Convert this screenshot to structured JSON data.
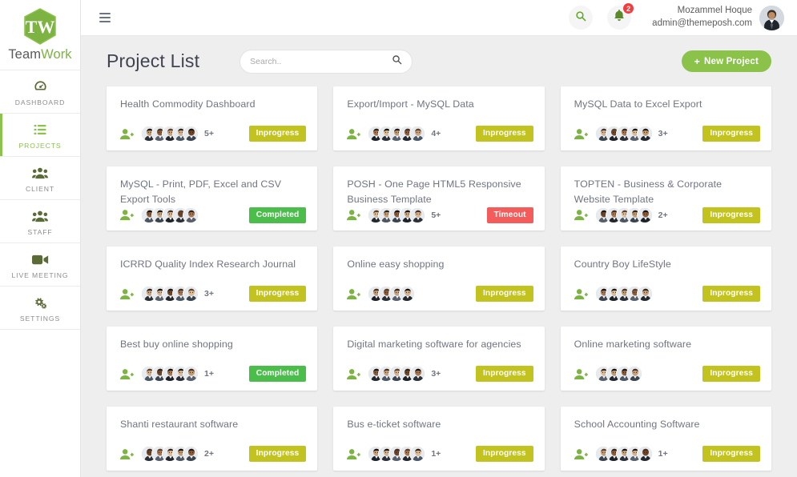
{
  "brand": {
    "name_part1": "Team",
    "name_part2": "Work",
    "logo_text": "TW"
  },
  "sidebar": {
    "items": [
      {
        "label": "DASHBOARD",
        "icon": "dashboard-icon",
        "active": false
      },
      {
        "label": "PROJECTS",
        "icon": "list-icon",
        "active": true
      },
      {
        "label": "CLIENT",
        "icon": "users-icon",
        "active": false
      },
      {
        "label": "STAFF",
        "icon": "users-icon",
        "active": false
      },
      {
        "label": "LIVE MEETING",
        "icon": "video-camera-icon",
        "active": false
      },
      {
        "label": "SETTINGS",
        "icon": "gears-icon",
        "active": false
      }
    ]
  },
  "topbar": {
    "menu_toggle_icon": "hamburger-icon",
    "search_icon": "search-icon",
    "notification_icon": "bell-icon",
    "notification_count": "2",
    "user_name": "Mozammel Hoque",
    "user_email": "admin@themeposh.com",
    "avatar_icon": "user-avatar"
  },
  "page": {
    "title": "Project List",
    "search_placeholder": "Search..",
    "search_value": "",
    "search_icon": "search-icon",
    "new_project_label": "New Project",
    "new_project_plus": "+"
  },
  "colors": {
    "accent_green": "#8bc34a",
    "status_inprogress": "#c2c31e",
    "status_completed": "#4bbd4b",
    "status_timeout": "#f45b5b",
    "badge_red": "#f03e3e",
    "page_background": "#eeeeee"
  },
  "projects": [
    {
      "title": "Health Commodity Dashboard",
      "members": 5,
      "count": "5+",
      "status": "Inprogress",
      "status_class": "st-inprogress"
    },
    {
      "title": "Export/Import - MySQL Data",
      "members": 5,
      "count": "4+",
      "status": "Inprogress",
      "status_class": "st-inprogress"
    },
    {
      "title": "MySQL Data to Excel Export",
      "members": 5,
      "count": "3+",
      "status": "Inprogress",
      "status_class": "st-inprogress"
    },
    {
      "title": "MySQL - Print, PDF, Excel and CSV Export Tools",
      "members": 5,
      "count": "",
      "status": "Completed",
      "status_class": "st-completed"
    },
    {
      "title": "POSH - One Page HTML5 Responsive Business Template",
      "members": 5,
      "count": "5+",
      "status": "Timeout",
      "status_class": "st-timeout"
    },
    {
      "title": "TOPTEN - Business & Corporate Website Template",
      "members": 5,
      "count": "2+",
      "status": "Inprogress",
      "status_class": "st-inprogress"
    },
    {
      "title": "ICRRD Quality Index Research Journal",
      "members": 5,
      "count": "3+",
      "status": "Inprogress",
      "status_class": "st-inprogress"
    },
    {
      "title": "Online easy shopping",
      "members": 4,
      "count": "",
      "status": "Inprogress",
      "status_class": "st-inprogress"
    },
    {
      "title": "Country Boy LifeStyle",
      "members": 5,
      "count": "",
      "status": "Inprogress",
      "status_class": "st-inprogress"
    },
    {
      "title": "Best buy online shopping",
      "members": 5,
      "count": "1+",
      "status": "Completed",
      "status_class": "st-completed"
    },
    {
      "title": "Digital marketing software for agencies",
      "members": 5,
      "count": "3+",
      "status": "Inprogress",
      "status_class": "st-inprogress"
    },
    {
      "title": "Online marketing software",
      "members": 4,
      "count": "",
      "status": "Inprogress",
      "status_class": "st-inprogress"
    },
    {
      "title": "Shanti restaurant software",
      "members": 5,
      "count": "2+",
      "status": "Inprogress",
      "status_class": "st-inprogress"
    },
    {
      "title": "Bus e-ticket software",
      "members": 5,
      "count": "1+",
      "status": "Inprogress",
      "status_class": "st-inprogress"
    },
    {
      "title": "School Accounting Software",
      "members": 5,
      "count": "1+",
      "status": "Inprogress",
      "status_class": "st-inprogress"
    }
  ]
}
